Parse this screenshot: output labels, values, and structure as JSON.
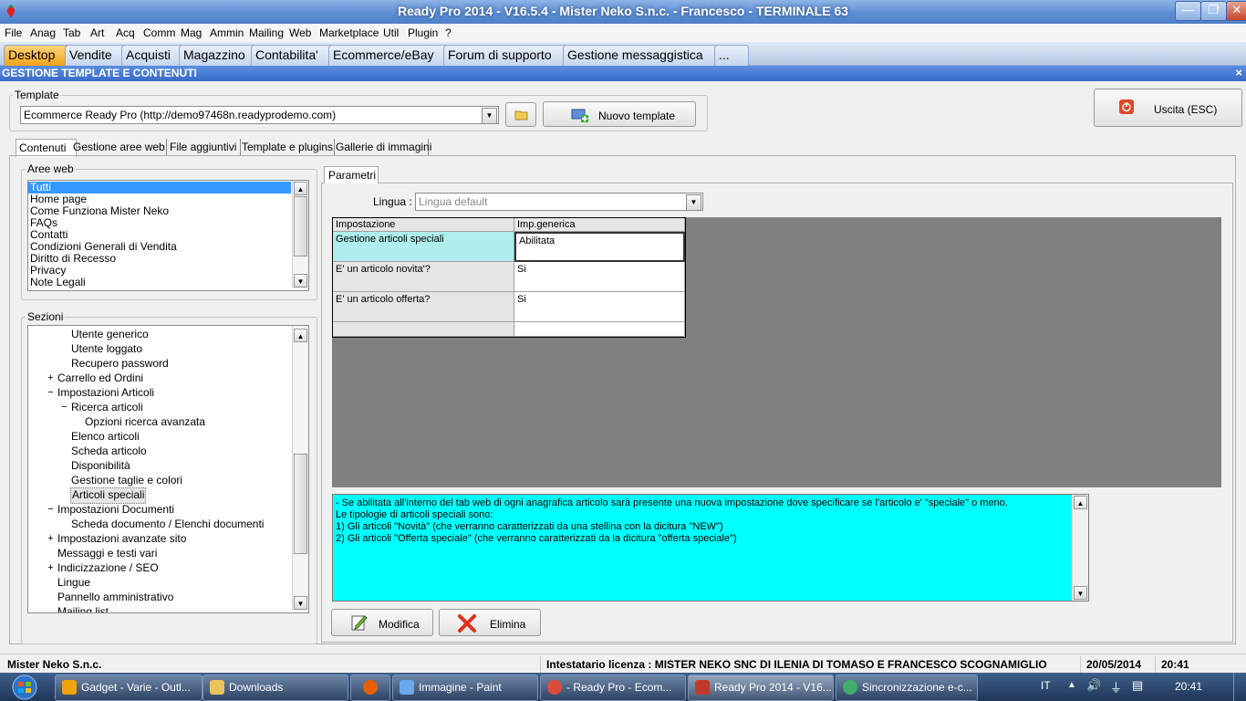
{
  "window": {
    "title": "Ready Pro 2014 - V16.5.4 - Mister Neko S.n.c. - Francesco - TERMINALE 63",
    "min_label": "—",
    "max_label": "❐",
    "close_label": "✕"
  },
  "menu": [
    "File",
    "Anag",
    "Tab",
    "Art",
    "Acq",
    "Comm",
    "Mag",
    "Ammin",
    "Mailing",
    "Web",
    "Marketplace",
    "Util",
    "Plugin",
    "?"
  ],
  "module_tabs": [
    "Desktop",
    "Vendite",
    "Acquisti",
    "Magazzino",
    "Contabilita'",
    "Ecommerce/eBay",
    "Forum di supporto",
    "Gestione messaggistica",
    "..."
  ],
  "panel": {
    "title": "GESTIONE TEMPLATE E CONTENUTI",
    "close_label": "×"
  },
  "template": {
    "group_label": "Template",
    "selected": "Ecommerce Ready Pro (http://demo97468n.readyprodemo.com)",
    "new_button": "Nuovo template",
    "exit_button": "Uscita (ESC)"
  },
  "sub_tabs": [
    "Contenuti",
    "Gestione aree web",
    "File aggiuntivi",
    "Template e plugins",
    "Gallerie di immagini"
  ],
  "aree_web": {
    "label": "Aree web",
    "items": [
      "Tutti",
      "Home page",
      "Come Funziona Mister Neko",
      "FAQs",
      "Contatti",
      "Condizioni Generali di Vendita",
      "Diritto di Recesso",
      "Privacy",
      "Note Legali"
    ]
  },
  "sezioni": {
    "label": "Sezioni",
    "items": [
      {
        "text": "Utente generico",
        "expander": ""
      },
      {
        "text": "Utente loggato",
        "expander": ""
      },
      {
        "text": "Recupero password",
        "expander": ""
      },
      {
        "text": "Carrello ed Ordini",
        "expander": "+"
      },
      {
        "text": "Impostazioni Articoli",
        "expander": "−"
      },
      {
        "text": "Ricerca articoli",
        "expander": "−"
      },
      {
        "text": "Opzioni ricerca avanzata",
        "expander": ""
      },
      {
        "text": "Elenco articoli",
        "expander": ""
      },
      {
        "text": "Scheda articolo",
        "expander": ""
      },
      {
        "text": "Disponibilità",
        "expander": ""
      },
      {
        "text": "Gestione taglie e colori",
        "expander": ""
      },
      {
        "text": "Articoli speciali",
        "expander": ""
      },
      {
        "text": "Impostazioni Documenti",
        "expander": "−"
      },
      {
        "text": "Scheda documento / Elenchi documenti",
        "expander": ""
      },
      {
        "text": "Impostazioni avanzate sito",
        "expander": "+"
      },
      {
        "text": "Messaggi e testi vari",
        "expander": ""
      },
      {
        "text": "Indicizzazione / SEO",
        "expander": "+"
      },
      {
        "text": "Lingue",
        "expander": ""
      },
      {
        "text": "Pannello amministrativo",
        "expander": ""
      },
      {
        "text": "Mailing list",
        "expander": ""
      }
    ]
  },
  "parametri": {
    "tab": "Parametri",
    "lingua_label": "Lingua :",
    "lingua_value": "Lingua default",
    "headers": [
      "Impostazione",
      "Imp.generica"
    ],
    "rows": [
      {
        "setting": "Gestione articoli speciali",
        "value": "Abilitata"
      },
      {
        "setting": "E' un articolo novita'?",
        "value": "Si"
      },
      {
        "setting": "E' un articolo offerta?",
        "value": "Si"
      }
    ]
  },
  "description": [
    "- Se abilitata all'interno del tab web di ogni anagrafica articolo sarà presente una nuova impostazione dove specificare se l'articolo e' \"speciale\" o meno.",
    "Le tipologie di articoli speciali sono:",
    "1) Gli articoli \"Novità\" (che verranno caratterizzati da una stellina con la dicitura \"NEW\")",
    "2) Gli articoli \"Offerta speciale\" (che verranno caratterizzati da la dicitura \"offerta speciale\")"
  ],
  "buttons": {
    "modifica": "Modifica",
    "elimina": "Elimina"
  },
  "status": {
    "company": "Mister Neko S.n.c.",
    "license": "Intestatario licenza : MISTER NEKO SNC DI ILENIA DI TOMASO E FRANCESCO SCOGNAMIGLIO",
    "date": "20/05/2014",
    "time": "20:41"
  },
  "taskbar": {
    "items": [
      {
        "label": "Gadget - Varie - Outl...",
        "icon": "outlook-icon",
        "color": "#f0a30a"
      },
      {
        "label": "Downloads",
        "icon": "folder-icon",
        "color": "#e8c45a"
      },
      {
        "label": "",
        "icon": "firefox-icon",
        "color": "#e66000"
      },
      {
        "label": "Immagine - Paint",
        "icon": "paint-icon",
        "color": "#6aa9e9"
      },
      {
        "label": "- Ready Pro - Ecom...",
        "icon": "chrome-icon",
        "color": "#dd4b39"
      },
      {
        "label": "Ready Pro 2014 - V16...",
        "icon": "readypro-icon",
        "color": "#c0392b"
      },
      {
        "label": "Sincronizzazione e-c...",
        "icon": "sync-icon",
        "color": "#3fae6a"
      }
    ],
    "lang": "IT",
    "clock": "20:41"
  },
  "colors": {
    "accent_tab": "#f3a417",
    "panel_header": "#3a6cc9",
    "grid_selected": "#b0eeee",
    "description_bg": "#00ffff"
  }
}
